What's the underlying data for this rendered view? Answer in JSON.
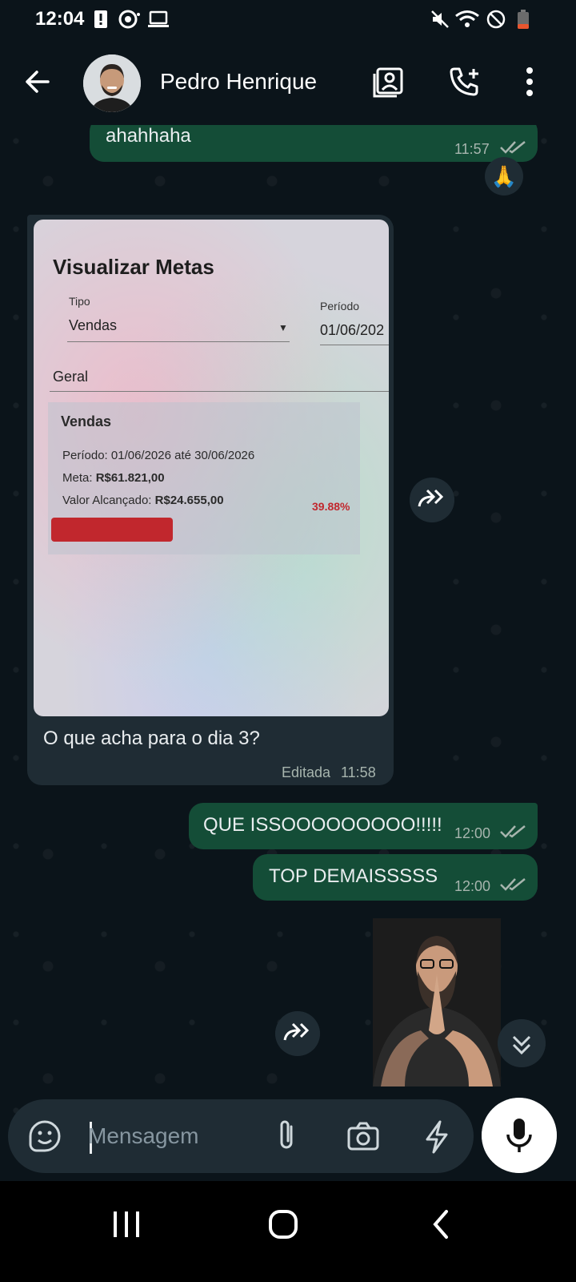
{
  "status_bar": {
    "time": "12:04",
    "icons": [
      "alert-icon",
      "assistant-icon",
      "laptop-icon",
      "mute-icon",
      "wifi-icon",
      "do-not-disturb-icon",
      "battery-icon"
    ]
  },
  "header": {
    "contact_name": "Pedro Henrique",
    "actions": [
      "contact-card-icon",
      "add-call-icon",
      "more-options-icon"
    ]
  },
  "messages": [
    {
      "direction": "out",
      "text": "ahahhaha",
      "time": "11:57",
      "status": "read",
      "reaction": "🙏"
    },
    {
      "direction": "in",
      "type": "image",
      "caption": "O que acha para o dia 3?",
      "edited_label": "Editada",
      "time": "11:58",
      "image_content": {
        "title": "Visualizar Metas",
        "tipo_label": "Tipo",
        "tipo_value": "Vendas",
        "periodo_label": "Período",
        "periodo_value": "01/06/202",
        "geral": "Geral",
        "card_title": "Vendas",
        "periodo_line_label": "Período:",
        "periodo_line_value": "01/06/2026 até 30/06/2026",
        "meta_label": "Meta:",
        "meta_value": "R$61.821,00",
        "valor_label": "Valor Alcançado:",
        "valor_value": "R$24.655,00",
        "percent": "39.88%",
        "progress": 0.3988
      }
    },
    {
      "direction": "out",
      "text": "QUE ISSOOOOOOOOO!!!!!",
      "time": "12:00",
      "status": "read"
    },
    {
      "direction": "out",
      "text": "TOP DEMAISSSSS",
      "time": "12:00",
      "status": "read"
    },
    {
      "direction": "in",
      "type": "sticker",
      "description": "praying-man-sticker"
    }
  ],
  "composer": {
    "placeholder": "Mensagem"
  },
  "colors": {
    "background": "#0b141a",
    "bubble_out": "#144d37",
    "bubble_in": "#1f2c34",
    "tick_read": "#a7b5ae"
  }
}
